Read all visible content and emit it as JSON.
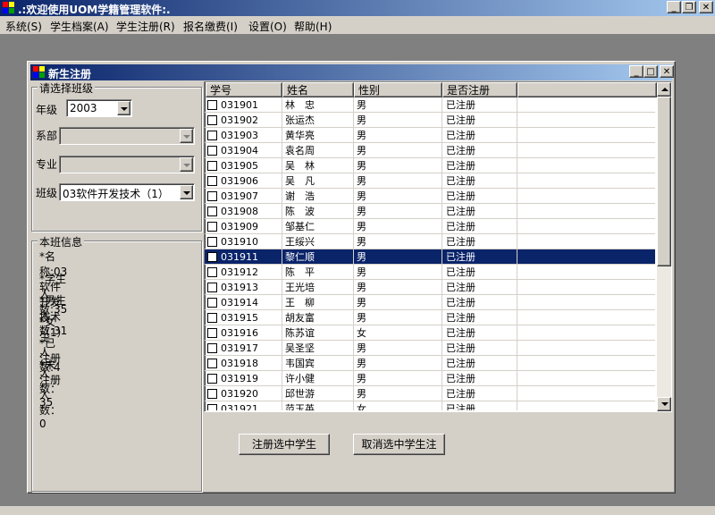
{
  "app": {
    "title": ".:欢迎使用UOM学籍管理软件:."
  },
  "window_controls": {
    "minimize": "_",
    "restore": "❐",
    "close": "✕"
  },
  "menu": [
    {
      "label": "系统(S)"
    },
    {
      "label": "学生档案(A)"
    },
    {
      "label": "学生注册(R)"
    },
    {
      "label": "报名缴费(I)"
    },
    {
      "label": "设置(O)"
    },
    {
      "label": "帮助(H)"
    }
  ],
  "child": {
    "title": "新生注册"
  },
  "class_select": {
    "legend": "请选择班级",
    "grade_label": "年级",
    "grade_value": "2003",
    "dept_label": "系部",
    "dept_value": "",
    "major_label": "专业",
    "major_value": "",
    "class_label": "班级",
    "class_value": "03软件开发技术（1）"
  },
  "class_info": {
    "legend": "本班信息",
    "lines": [
      "*名称:03软件开发技术（1）",
      "*学生人数:35",
      "*男生人数:31",
      "*女生人数:4",
      "*已注册人数：35",
      "*未注册人数：0"
    ]
  },
  "grid": {
    "columns": [
      "学号",
      "姓名",
      "性别",
      "是否注册"
    ],
    "selected_index": 10,
    "rows": [
      {
        "id": "031901",
        "name": "林　忠",
        "sex": "男",
        "status": "已注册"
      },
      {
        "id": "031902",
        "name": "张运杰",
        "sex": "男",
        "status": "已注册"
      },
      {
        "id": "031903",
        "name": "黄华亮",
        "sex": "男",
        "status": "已注册"
      },
      {
        "id": "031904",
        "name": "袁名周",
        "sex": "男",
        "status": "已注册"
      },
      {
        "id": "031905",
        "name": "吴　林",
        "sex": "男",
        "status": "已注册"
      },
      {
        "id": "031906",
        "name": "吴　凡",
        "sex": "男",
        "status": "已注册"
      },
      {
        "id": "031907",
        "name": "谢　浩",
        "sex": "男",
        "status": "已注册"
      },
      {
        "id": "031908",
        "name": "陈　波",
        "sex": "男",
        "status": "已注册"
      },
      {
        "id": "031909",
        "name": "邹基仁",
        "sex": "男",
        "status": "已注册"
      },
      {
        "id": "031910",
        "name": "王绥兴",
        "sex": "男",
        "status": "已注册"
      },
      {
        "id": "031911",
        "name": "黎仁顺",
        "sex": "男",
        "status": "已注册"
      },
      {
        "id": "031912",
        "name": "陈　平",
        "sex": "男",
        "status": "已注册"
      },
      {
        "id": "031913",
        "name": "王光培",
        "sex": "男",
        "status": "已注册"
      },
      {
        "id": "031914",
        "name": "王　柳",
        "sex": "男",
        "status": "已注册"
      },
      {
        "id": "031915",
        "name": "胡友富",
        "sex": "男",
        "status": "已注册"
      },
      {
        "id": "031916",
        "name": "陈苏谊",
        "sex": "女",
        "status": "已注册"
      },
      {
        "id": "031917",
        "name": "吴圣坚",
        "sex": "男",
        "status": "已注册"
      },
      {
        "id": "031918",
        "name": "韦国宾",
        "sex": "男",
        "status": "已注册"
      },
      {
        "id": "031919",
        "name": "许小健",
        "sex": "男",
        "status": "已注册"
      },
      {
        "id": "031920",
        "name": "邱世游",
        "sex": "男",
        "status": "已注册"
      },
      {
        "id": "031921",
        "name": "范玉英",
        "sex": "女",
        "status": "已注册"
      }
    ]
  },
  "buttons": {
    "register": "注册选中学生",
    "cancel": "取消选中学生注"
  }
}
